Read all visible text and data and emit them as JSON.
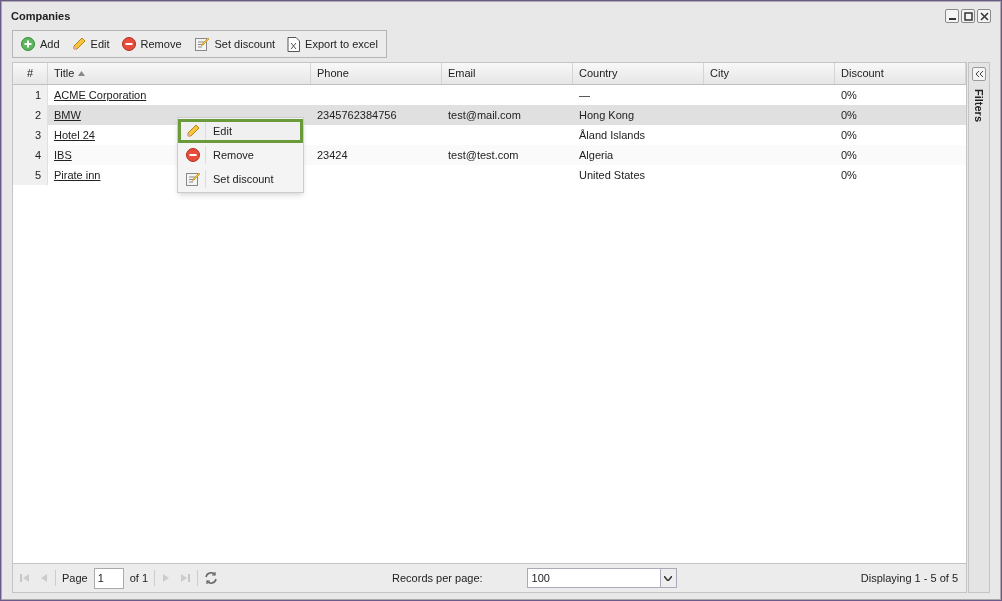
{
  "window": {
    "title": "Companies"
  },
  "toolbar": [
    {
      "label": "Add"
    },
    {
      "label": "Edit"
    },
    {
      "label": "Remove"
    },
    {
      "label": "Set discount"
    },
    {
      "label": "Export to excel"
    }
  ],
  "table": {
    "columns": [
      {
        "label": "#",
        "sorted": false
      },
      {
        "label": "Title",
        "sorted": true
      },
      {
        "label": "Phone",
        "sorted": false
      },
      {
        "label": "Email",
        "sorted": false
      },
      {
        "label": "Country",
        "sorted": false
      },
      {
        "label": "City",
        "sorted": false
      },
      {
        "label": "Discount",
        "sorted": false
      }
    ],
    "rows": [
      {
        "selected": false,
        "cells": [
          "1",
          "ACME Corporation",
          "",
          "",
          "—",
          "",
          "0%"
        ]
      },
      {
        "selected": true,
        "cells": [
          "2",
          "BMW",
          "2345762384756",
          "test@mail.com",
          "Hong Kong",
          "",
          "0%"
        ]
      },
      {
        "selected": false,
        "cells": [
          "3",
          "Hotel 24",
          "",
          "",
          "Åland Islands",
          "",
          "0%"
        ]
      },
      {
        "selected": false,
        "cells": [
          "4",
          "IBS",
          "23424",
          "test@test.com",
          "Algeria",
          "",
          "0%"
        ]
      },
      {
        "selected": false,
        "cells": [
          "5",
          "Pirate inn",
          "",
          "",
          "United States",
          "",
          "0%"
        ]
      }
    ]
  },
  "context_menu": [
    {
      "label": "Edit",
      "selected": true
    },
    {
      "label": "Remove",
      "selected": false
    },
    {
      "label": "Set discount",
      "selected": false
    }
  ],
  "filters_panel": {
    "title": "Filters"
  },
  "paging": {
    "page_label": "Page",
    "page": "1",
    "of": "of 1",
    "records_label": "Records per page:",
    "records": "100",
    "display": "Displaying 1 - 5 of 5"
  }
}
